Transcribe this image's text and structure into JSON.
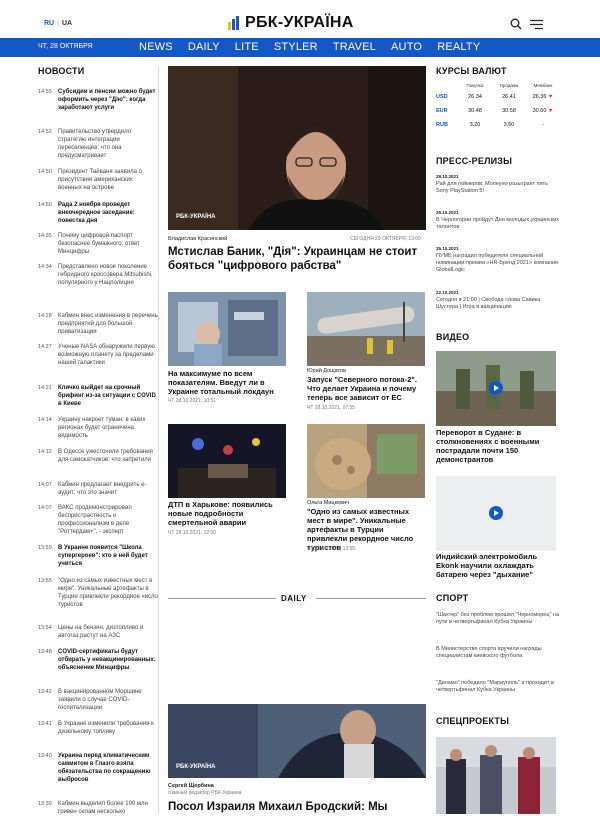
{
  "header": {
    "lang_ru": "RU",
    "lang_ua": "UA",
    "logo_text": "РБК-УКРАЇНА"
  },
  "nav": {
    "date": "ЧТ, 28 ОКТЯБРЯ",
    "items": [
      "NEWS",
      "DAILY",
      "LITE",
      "STYLER",
      "TRAVEL",
      "AUTO",
      "REALTY"
    ]
  },
  "news": {
    "title": "НОВОСТИ",
    "items": [
      {
        "time": "14:55",
        "text": "Субсидии и пенсии можно будет оформить через \"Дію\": когда заработают услуги",
        "bold": true
      },
      {
        "time": "14:52",
        "text": "Правительство утвердило стратегию интеграции переселенцев: что она предусматривает",
        "bold": false
      },
      {
        "time": "14:50",
        "text": "Президент Тайваня заявила о присутствии американских военных на острове",
        "bold": false
      },
      {
        "time": "14:50",
        "text": "Рада 2 ноября проведет внеочередное заседание: повестка дня",
        "bold": true
      },
      {
        "time": "14:35",
        "text": "Почему цифровой паспорт безопаснее бумажного: ответ Минцифры",
        "bold": false
      },
      {
        "time": "14:34",
        "text": "Представлено новое поколение гибридного кроссовера Mitsubishi, популярного у Нацполиции",
        "bold": false
      },
      {
        "time": "14:28",
        "text": "Кабмин внес изменения в перечень предприятий для большой приватизации",
        "bold": false
      },
      {
        "time": "14:27",
        "text": "Ученые NASA обнаружили первую возможную планету за пределами нашей галактики",
        "bold": false
      },
      {
        "time": "14:21",
        "text": "Кличко выйдет на срочный брифинг из-за ситуации с COVID в Киеве",
        "bold": true
      },
      {
        "time": "14:14",
        "text": "Украину накроет туман: в каких регионах будет ограничена видимость",
        "bold": false
      },
      {
        "time": "14:12",
        "text": "В Одессе ужесточили требования для самокатчиков: что запретили",
        "bold": false
      },
      {
        "time": "14:07",
        "text": "Кабмин предлагает внедрить е-аудит: что это значит",
        "bold": false
      },
      {
        "time": "14:07",
        "text": "ВАКС продемонстрировал беспристрастность и профессионализм в деле \"Роттердам+\", - эксперт",
        "bold": false
      },
      {
        "time": "13:59",
        "text": "В Украине появится \"Школа супергероев\": кто в ней будет учиться",
        "bold": true
      },
      {
        "time": "13:55",
        "text": "\"Одно из самых известных мест в мире\". Уникальные артефакты в Турции привлекли рекордное число туристов",
        "bold": false
      },
      {
        "time": "13:54",
        "text": "Цены на бензин, дизтопливо и автогаз растут на АЗС",
        "bold": false
      },
      {
        "time": "13:48",
        "text": "COVID-сертификаты будут отбирать у невакцинированных: объяснение Минцифры",
        "bold": true
      },
      {
        "time": "13:42",
        "text": "В вакцинированном Моршине заявили о случае COVID-госпитализации",
        "bold": false
      },
      {
        "time": "13:41",
        "text": "В Украине изменили требования к дизельному топливу",
        "bold": false
      },
      {
        "time": "13:40",
        "text": "Украина перед климатическим саммитом в Глазго взяла обязательства по сокращению выбросов",
        "bold": true
      },
      {
        "time": "13:39",
        "text": "Кабмин выделил более 100 млн гривен селам несколько",
        "bold": false
      }
    ]
  },
  "hero": {
    "badge": "РБК-УКРАЇНА",
    "author": "Владислав Красинский",
    "date": "СЕГОДНЯ 29 ОКТЯБРЯ, 13:00",
    "title": "Мстислав Баник, \"Дія\": Украинцам не стоит бояться \"цифрового рабства\""
  },
  "cards": [
    {
      "title": "На максимуме по всем показателям. Введут ли в Украине тотальный локдаун",
      "date": "ЧТ 28.10.2021, 10:51",
      "author": ""
    },
    {
      "title": "Запуск \"Северного потока-2\". Что делает Украина и почему теперь все зависит от ЕС",
      "date": "ЧТ 28.10.2021, 07:55",
      "author": "Юрий Дощатов"
    },
    {
      "title": "ДТП в Харькове: появились новые подробности смертельной аварии",
      "date": "ЧТ 28.10.2021, 12:00",
      "author": ""
    },
    {
      "title": "\"Одно из самых известных мест в мире\". Уникальные артефакты в Турции привлекли рекордное число туристов",
      "date": "ЧТ 28.10.2021, 13:55",
      "author": "Ольга Мицкевич"
    }
  ],
  "daily": {
    "label": "DAILY",
    "badge": "РБК-УКРАЇНА",
    "author": "Сергей Щербина",
    "author_role": "главный редактор РБК-Украина",
    "title": "Посол Израиля Михаил Бродский: Мы"
  },
  "rates": {
    "title": "КУРСЫ ВАЛЮТ",
    "headers": [
      "Покупка",
      "Продажа",
      "Межбанк"
    ],
    "rows": [
      {
        "cur": "USD",
        "buy": "26.34",
        "sell": "26.41",
        "inter": "26.36"
      },
      {
        "cur": "EUR",
        "buy": "30.48",
        "sell": "30.58",
        "inter": "30.60"
      },
      {
        "cur": "RUB",
        "buy": "3.20",
        "sell": "3.60",
        "inter": "-"
      }
    ],
    "down_color": "#d9302e"
  },
  "press": {
    "title": "ПРЕСС-РЕЛИЗЫ",
    "items": [
      {
        "date": "28.10.2021",
        "text": "Рай для геймеров: Мопеуно разыграет пять Sony PlayStation 5!"
      },
      {
        "date": "25.10.2021",
        "text": "В Черногории пройдут Дни молодых украинских талантов"
      },
      {
        "date": "25.10.2021",
        "text": "ПУМБ наградил победителя специальной номинации премии «HR-Бренд 2021» компании GlobalLogic"
      },
      {
        "date": "22.10.2021",
        "text": "Сегодня в 21:00 | Свобода слова Савика Шустера | Игра в вакцинацию"
      }
    ]
  },
  "video": {
    "title": "ВИДЕО",
    "items": [
      {
        "title": "Переворот в Судане: в столкновениях с военными пострадали почти 150 демонстрантов"
      },
      {
        "title": "Индийский электромобиль Ekonk научили охлаждать батарею через \"дыхание\""
      }
    ]
  },
  "sport": {
    "title": "СПОРТ",
    "items": [
      "\"Шахтер\" без проблем прошел \"Черноморец\" на пути в четвертьфинал Кубка Украины",
      "В Министерстве спорта вручили награды специалистам киевского футбола",
      "\"Динамо\" победило \"Мариуполь\" и проходит в четвертьфинал Кубка Украины"
    ]
  },
  "special": {
    "title": "СПЕЦПРОЕКТЫ"
  },
  "colors": {
    "brand_blue": "#1458c7",
    "brand_yellow": "#f2c200"
  }
}
